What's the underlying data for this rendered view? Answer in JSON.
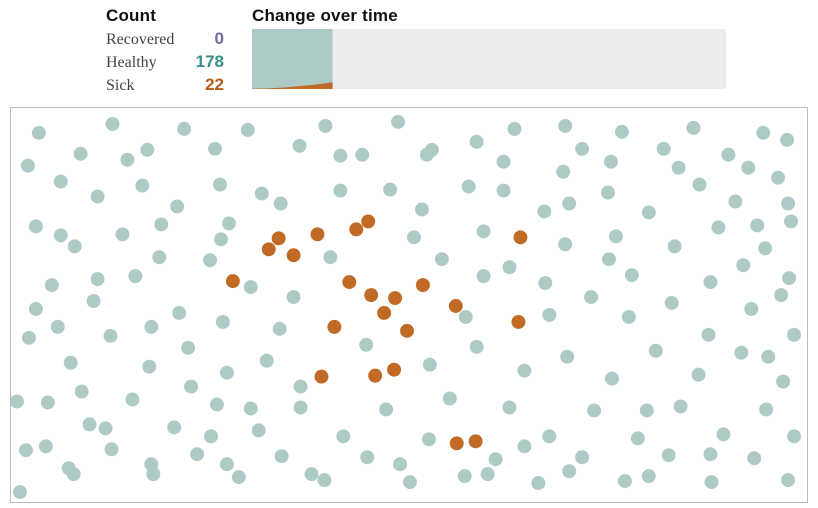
{
  "header": {
    "count_title": "Count",
    "timeline_title": "Change over time",
    "recovered_label": "Recovered",
    "healthy_label": "Healthy",
    "sick_label": "Sick",
    "recovered_value": "0",
    "healthy_value": "178",
    "sick_value": "22"
  },
  "chart_data": {
    "timeline": {
      "type": "area",
      "width_fraction_elapsed": 0.17,
      "series": [
        {
          "name": "Recovered",
          "color": "#8d7fb0",
          "values": [
            0,
            0,
            0,
            0,
            0,
            0
          ]
        },
        {
          "name": "Healthy",
          "color": "#aecac7",
          "values": [
            199,
            198,
            195,
            190,
            185,
            178
          ]
        },
        {
          "name": "Sick",
          "color": "#c16a25",
          "values": [
            1,
            2,
            5,
            10,
            15,
            22
          ]
        }
      ],
      "total_population": 200
    },
    "simulation": {
      "type": "scatter",
      "title": "",
      "xlim": [
        0,
        798
      ],
      "ylim": [
        0,
        396
      ],
      "colors": {
        "healthy": "#aecac7",
        "sick": "#c16a25",
        "recovered": "#8d7fb0"
      },
      "sick_points": [
        [
          258,
          142
        ],
        [
          268,
          131
        ],
        [
          283,
          148
        ],
        [
          307,
          127
        ],
        [
          346,
          122
        ],
        [
          358,
          114
        ],
        [
          222,
          174
        ],
        [
          413,
          178
        ],
        [
          339,
          175
        ],
        [
          361,
          188
        ],
        [
          374,
          206
        ],
        [
          385,
          191
        ],
        [
          446,
          199
        ],
        [
          324,
          220
        ],
        [
          397,
          224
        ],
        [
          509,
          215
        ],
        [
          511,
          130
        ],
        [
          384,
          263
        ],
        [
          311,
          270
        ],
        [
          365,
          269
        ],
        [
          447,
          337
        ],
        [
          466,
          335
        ]
      ],
      "healthy_points": [
        [
          27,
          25
        ],
        [
          69,
          46
        ],
        [
          101,
          16
        ],
        [
          136,
          42
        ],
        [
          173,
          21
        ],
        [
          204,
          41
        ],
        [
          237,
          22
        ],
        [
          289,
          38
        ],
        [
          315,
          18
        ],
        [
          352,
          47
        ],
        [
          388,
          14
        ],
        [
          417,
          47
        ],
        [
          467,
          34
        ],
        [
          505,
          21
        ],
        [
          556,
          18
        ],
        [
          573,
          41
        ],
        [
          613,
          24
        ],
        [
          655,
          41
        ],
        [
          685,
          20
        ],
        [
          720,
          47
        ],
        [
          755,
          25
        ],
        [
          779,
          32
        ],
        [
          49,
          74
        ],
        [
          86,
          89
        ],
        [
          131,
          78
        ],
        [
          166,
          99
        ],
        [
          209,
          77
        ],
        [
          251,
          86
        ],
        [
          330,
          83
        ],
        [
          412,
          102
        ],
        [
          494,
          83
        ],
        [
          554,
          64
        ],
        [
          599,
          85
        ],
        [
          640,
          105
        ],
        [
          691,
          77
        ],
        [
          727,
          94
        ],
        [
          770,
          70
        ],
        [
          24,
          119
        ],
        [
          63,
          139
        ],
        [
          111,
          127
        ],
        [
          150,
          117
        ],
        [
          199,
          153
        ],
        [
          218,
          116
        ],
        [
          474,
          124
        ],
        [
          556,
          137
        ],
        [
          607,
          129
        ],
        [
          666,
          139
        ],
        [
          710,
          120
        ],
        [
          757,
          141
        ],
        [
          783,
          114
        ],
        [
          40,
          178
        ],
        [
          82,
          194
        ],
        [
          124,
          169
        ],
        [
          168,
          206
        ],
        [
          212,
          215
        ],
        [
          269,
          222
        ],
        [
          474,
          169
        ],
        [
          536,
          176
        ],
        [
          582,
          190
        ],
        [
          623,
          168
        ],
        [
          663,
          196
        ],
        [
          702,
          175
        ],
        [
          743,
          202
        ],
        [
          781,
          171
        ],
        [
          17,
          231
        ],
        [
          59,
          256
        ],
        [
          99,
          229
        ],
        [
          138,
          260
        ],
        [
          177,
          241
        ],
        [
          216,
          266
        ],
        [
          256,
          254
        ],
        [
          420,
          258
        ],
        [
          467,
          240
        ],
        [
          515,
          264
        ],
        [
          558,
          250
        ],
        [
          603,
          272
        ],
        [
          647,
          244
        ],
        [
          690,
          268
        ],
        [
          733,
          246
        ],
        [
          775,
          275
        ],
        [
          36,
          296
        ],
        [
          78,
          318
        ],
        [
          121,
          293
        ],
        [
          163,
          321
        ],
        [
          206,
          298
        ],
        [
          248,
          324
        ],
        [
          290,
          301
        ],
        [
          333,
          330
        ],
        [
          376,
          303
        ],
        [
          419,
          333
        ],
        [
          500,
          301
        ],
        [
          540,
          330
        ],
        [
          585,
          304
        ],
        [
          629,
          332
        ],
        [
          672,
          300
        ],
        [
          715,
          328
        ],
        [
          758,
          303
        ],
        [
          786,
          330
        ],
        [
          14,
          344
        ],
        [
          57,
          362
        ],
        [
          100,
          343
        ],
        [
          142,
          368
        ],
        [
          186,
          348
        ],
        [
          228,
          371
        ],
        [
          271,
          350
        ],
        [
          314,
          374
        ],
        [
          357,
          351
        ],
        [
          400,
          376
        ],
        [
          486,
          353
        ],
        [
          529,
          377
        ],
        [
          573,
          351
        ],
        [
          616,
          375
        ],
        [
          660,
          349
        ],
        [
          703,
          376
        ],
        [
          746,
          352
        ],
        [
          780,
          374
        ],
        [
          8,
          386
        ],
        [
          270,
          96
        ],
        [
          459,
          79
        ],
        [
          432,
          152
        ],
        [
          283,
          190
        ],
        [
          356,
          238
        ],
        [
          70,
          285
        ],
        [
          380,
          82
        ],
        [
          535,
          104
        ],
        [
          49,
          128
        ],
        [
          786,
          228
        ],
        [
          330,
          48
        ],
        [
          390,
          358
        ],
        [
          440,
          292
        ],
        [
          210,
          132
        ],
        [
          116,
          52
        ],
        [
          602,
          54
        ],
        [
          494,
          54
        ],
        [
          740,
          60
        ],
        [
          455,
          370
        ],
        [
          16,
          58
        ],
        [
          5,
          295
        ],
        [
          773,
          188
        ],
        [
          515,
          340
        ],
        [
          240,
          180
        ],
        [
          148,
          150
        ],
        [
          301,
          368
        ],
        [
          540,
          208
        ],
        [
          24,
          202
        ],
        [
          735,
          158
        ],
        [
          180,
          280
        ],
        [
          456,
          210
        ],
        [
          240,
          302
        ],
        [
          620,
          210
        ],
        [
          760,
          250
        ],
        [
          290,
          280
        ],
        [
          62,
          368
        ],
        [
          640,
          370
        ],
        [
          600,
          152
        ],
        [
          140,
          358
        ],
        [
          500,
          160
        ],
        [
          320,
          150
        ],
        [
          94,
          322
        ],
        [
          404,
          130
        ],
        [
          700,
          228
        ],
        [
          86,
          172
        ],
        [
          216,
          358
        ],
        [
          560,
          365
        ],
        [
          702,
          348
        ],
        [
          140,
          220
        ],
        [
          670,
          60
        ],
        [
          749,
          118
        ],
        [
          200,
          330
        ],
        [
          560,
          96
        ],
        [
          780,
          96
        ],
        [
          46,
          220
        ],
        [
          422,
          42
        ],
        [
          34,
          340
        ],
        [
          638,
          304
        ],
        [
          478,
          368
        ]
      ]
    }
  }
}
